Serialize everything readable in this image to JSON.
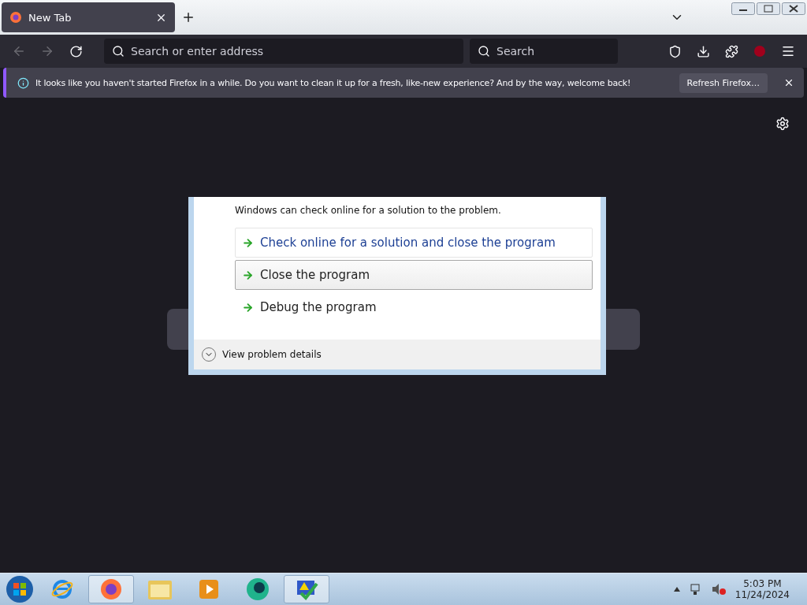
{
  "tabs": [
    {
      "title": "New Tab",
      "selected": true
    }
  ],
  "toolbar": {
    "back_disabled": true,
    "forward_disabled": true,
    "address": {
      "placeholder": "Search or enter address"
    },
    "search": {
      "placeholder": "Search"
    }
  },
  "notification": {
    "message": "It looks like you haven't started Firefox in a while. Do you want to clean it up for a fresh, like-new experience? And by the way, welcome back!",
    "button": "Refresh Firefox…"
  },
  "dialog": {
    "subtitle": "Windows can check online for a solution to the problem.",
    "commands": [
      {
        "label": "Check online for a solution and close the program",
        "selected": false,
        "focused": true
      },
      {
        "label": "Close the program",
        "selected": true,
        "focused": false
      },
      {
        "label": "Debug the program",
        "selected": false,
        "focused": false
      }
    ],
    "details": "View problem details"
  },
  "taskbar": {
    "apps": [
      {
        "kind": "ie",
        "open": false
      },
      {
        "kind": "firefox",
        "open": true
      },
      {
        "kind": "folder",
        "open": false
      },
      {
        "kind": "media",
        "open": false
      },
      {
        "kind": "orb",
        "open": false
      },
      {
        "kind": "tool",
        "open": true
      }
    ],
    "time": "5:03 PM",
    "date": "11/24/2024"
  }
}
